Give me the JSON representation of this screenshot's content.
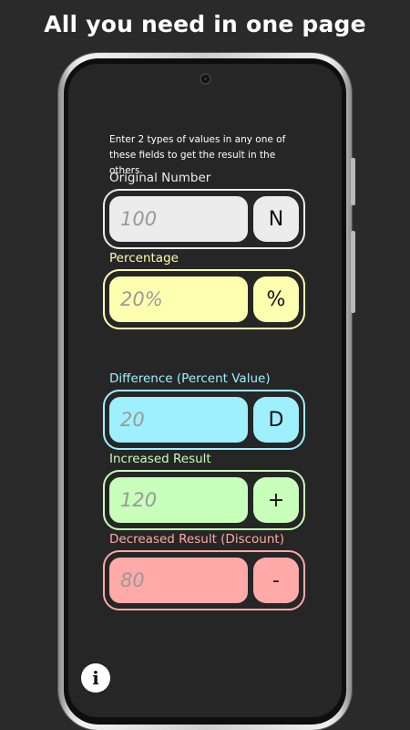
{
  "headline": "All you need in one page",
  "instructions": "Enter 2 types of values in any one of these fields to get the result in the others.",
  "colors": {
    "original": "#ececec",
    "percentage": "#ffffb0",
    "difference": "#9ef0ff",
    "increased": "#c8ffba",
    "decreased": "#ffaaa8"
  },
  "fields": {
    "original": {
      "label": "Original Number",
      "placeholder": "100",
      "button": "N"
    },
    "percentage": {
      "label": "Percentage",
      "placeholder": "20%",
      "button": "%"
    },
    "difference": {
      "label": "Difference (Percent Value)",
      "placeholder": "20",
      "button": "D"
    },
    "increased": {
      "label": "Increased Result",
      "placeholder": "120",
      "button": "+"
    },
    "decreased": {
      "label": "Decreased Result (Discount)",
      "placeholder": "80",
      "button": "-"
    }
  },
  "info_button": "i"
}
